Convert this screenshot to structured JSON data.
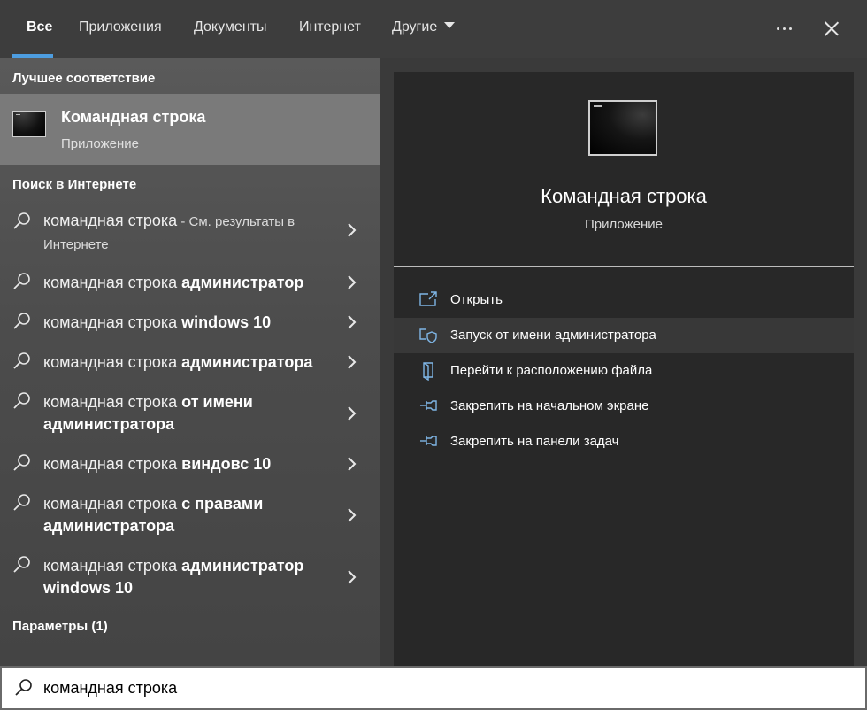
{
  "tabs": [
    {
      "label": "Все",
      "active": true
    },
    {
      "label": "Приложения"
    },
    {
      "label": "Документы"
    },
    {
      "label": "Интернет"
    },
    {
      "label": "Другие"
    }
  ],
  "left": {
    "best_match_heading": "Лучшее соответствие",
    "best_match": {
      "title": "Командная строка",
      "subtitle": "Приложение",
      "icon": "command-prompt-icon"
    },
    "web_heading": "Поиск в Интернете",
    "web_results": [
      {
        "query": "командная строка",
        "hint": " - См. результаты в",
        "hint2": "Интернете"
      },
      {
        "query": "командная строка ",
        "bold": "администратор"
      },
      {
        "query": "командная строка ",
        "bold": "windows 10"
      },
      {
        "query": "командная строка ",
        "bold": "администратора"
      },
      {
        "query": "командная строка ",
        "bold": "от имени",
        "line2": "администратора"
      },
      {
        "query": "командная строка ",
        "bold": "виндовс 10"
      },
      {
        "query": "командная строка ",
        "bold": "с правами",
        "line2": "администратора"
      },
      {
        "query": "командная строка ",
        "bold": "администратор",
        "line2": "windows 10"
      }
    ],
    "settings_heading": "Параметры (1)"
  },
  "right": {
    "title": "Командная строка",
    "subtitle": "Приложение",
    "actions": [
      {
        "label": "Открыть",
        "icon": "open-icon"
      },
      {
        "label": "Запуск от имени администратора",
        "icon": "shield-icon"
      },
      {
        "label": "Перейти к расположению файла",
        "icon": "file-location-icon"
      },
      {
        "label": "Закрепить на начальном экране",
        "icon": "pin-icon"
      },
      {
        "label": "Закрепить на панели задач",
        "icon": "pin-icon"
      }
    ]
  },
  "search": {
    "value": "командная строка"
  },
  "colors": {
    "accent": "#4d9de0",
    "icon_blue": "#7fb6e6"
  }
}
